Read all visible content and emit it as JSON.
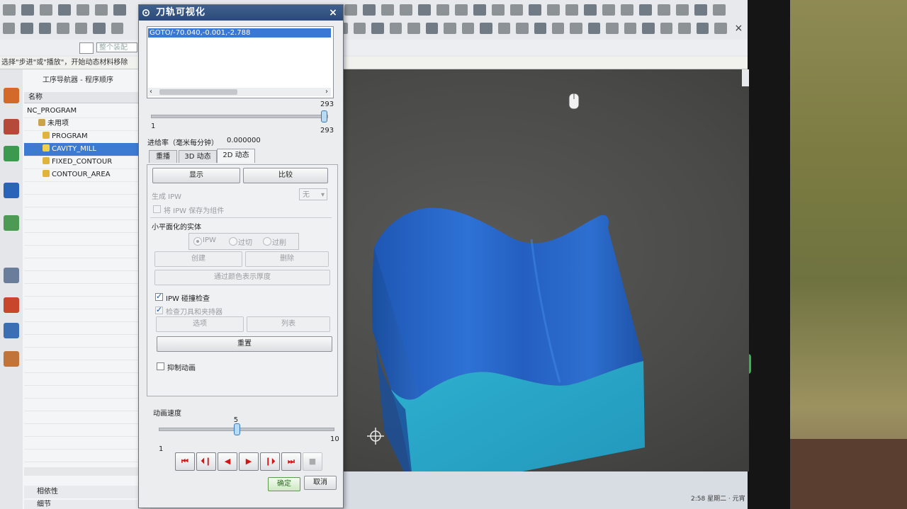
{
  "app": {
    "cue_line": "选择\"步进\"或\"播放\"，开始动态材料移除",
    "filter_placeholder": "整个装配"
  },
  "navigator": {
    "title": "工序导航器 - 程序顺序",
    "column_header": "名称",
    "rows": [
      {
        "label": "NC_PROGRAM"
      },
      {
        "label": "未用项"
      },
      {
        "label": "PROGRAM"
      },
      {
        "label": "CAVITY_MILL"
      },
      {
        "label": "FIXED_CONTOUR"
      },
      {
        "label": "CONTOUR_AREA"
      }
    ],
    "section_dependencies": "相依性",
    "section_details": "细节"
  },
  "dialog": {
    "title": "刀轨可视化",
    "close_glyph": "×",
    "list_item": "GOTO/-70.040,-0.001,-2.788",
    "list_left_arrow": "‹",
    "list_right_arrow": "›",
    "step_slider": {
      "value": 293,
      "max": 293,
      "min": 1,
      "max_label": "293",
      "min_label": "1",
      "value_label": "293"
    },
    "feed_rate_label": "进给率（毫米每分钟）",
    "feed_rate_value": "0.000000",
    "tabs": [
      "重播",
      "3D 动态",
      "2D 动态"
    ],
    "active_tab": "2D 动态",
    "buttons": {
      "display": "显示",
      "compare": "比较",
      "create": "创建",
      "delete": "删除",
      "color_thickness": "通过颜色表示厚度",
      "options": "选项",
      "list": "列表",
      "reset": "重置",
      "ok": "确定",
      "cancel": "取消"
    },
    "generate_ipw_label": "生成 IPW",
    "generate_ipw_value": "无",
    "save_ipw_label": "将 IPW 保存为组件",
    "facet_solid_label": "小平面化的实体",
    "radios": [
      "IPW",
      "过切",
      "过削"
    ],
    "ipw_collision_label": "IPW 碰撞检查",
    "check_tool_label": "检查刀具和夹持器",
    "suppress_anim_label": "抑制动画",
    "speed_label": "动画速度",
    "speed_slider": {
      "value": 5,
      "min": 1,
      "max": 10,
      "value_label": "5",
      "min_label": "1",
      "max_label": "10"
    },
    "vcr": [
      "⏮",
      "⏴❙",
      "◀",
      "▶",
      "❙⏵",
      "⏭",
      "■"
    ]
  },
  "taskbar": {
    "clock": "2:58 星期二 · 元宵"
  },
  "colors": {
    "blank_top": "#2d6fd0",
    "blank_side": "#2aa6c6",
    "dialog_title": "#2b4a78",
    "selection": "#3d7bd2",
    "vcr_glyph": "#d21414"
  }
}
